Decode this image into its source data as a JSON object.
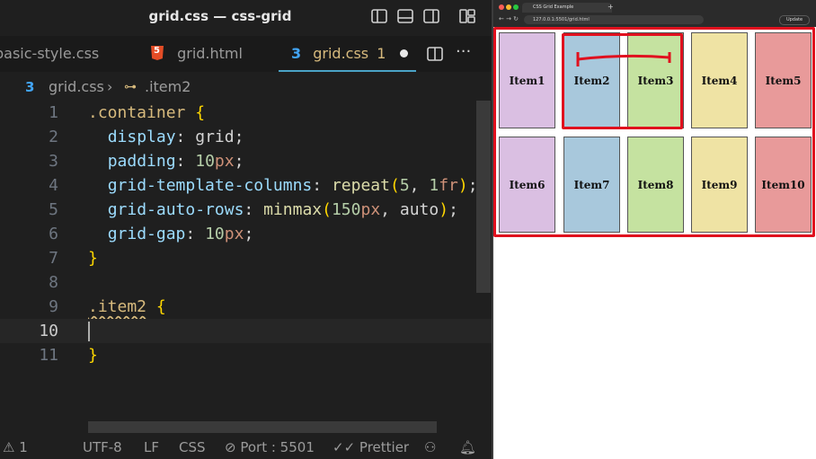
{
  "window": {
    "title": "grid.css — css-grid"
  },
  "tabs": [
    {
      "label": "basic-style.css"
    },
    {
      "label": "grid.html"
    },
    {
      "label": "grid.css",
      "badge": "1"
    }
  ],
  "breadcrumb": {
    "file": "grid.css",
    "symbol": ".item2"
  },
  "code": {
    "lines": [
      {
        "n": "1"
      },
      {
        "n": "2"
      },
      {
        "n": "3"
      },
      {
        "n": "4"
      },
      {
        "n": "5"
      },
      {
        "n": "6"
      },
      {
        "n": "7"
      },
      {
        "n": "8"
      },
      {
        "n": "9"
      },
      {
        "n": "10"
      },
      {
        "n": "11"
      }
    ],
    "l1": {
      "sel": ".container",
      "brace": "{"
    },
    "l2": {
      "prop": "display",
      "val": "grid"
    },
    "l3": {
      "prop": "padding",
      "num": "10",
      "unit": "px"
    },
    "l4": {
      "prop": "grid-template-columns",
      "fn": "repeat",
      "a1": "5",
      "a2": "1",
      "unit": "fr"
    },
    "l5": {
      "prop": "grid-auto-rows",
      "fn": "minmax",
      "a1": "150",
      "unit": "px",
      "a2": "auto"
    },
    "l6": {
      "prop": "grid-gap",
      "num": "10",
      "unit": "px"
    },
    "l7": {
      "brace": "}"
    },
    "l9": {
      "sel": ".item2",
      "brace": "{"
    },
    "l11": {
      "brace": "}"
    }
  },
  "statusbar": {
    "warnings": "1",
    "encoding": "UTF-8",
    "eol": "LF",
    "language": "CSS",
    "port": "Port : 5501",
    "formatter": "Prettier"
  },
  "browser": {
    "tab_title": "CSS Grid Example",
    "url": "127.0.0.1:5501/grid.html",
    "update_label": "Update"
  },
  "grid_items": [
    "Item1",
    "Item2",
    "Item3",
    "Item4",
    "Item5",
    "Item6",
    "Item7",
    "Item8",
    "Item9",
    "Item10"
  ],
  "colors": {
    "outline": "#e0101e",
    "item_purple": "#dabfe2",
    "item_blue": "#a8c8dc",
    "item_green": "#c5e2a0",
    "item_yellow": "#efe3a4",
    "item_red": "#e89a9a"
  }
}
